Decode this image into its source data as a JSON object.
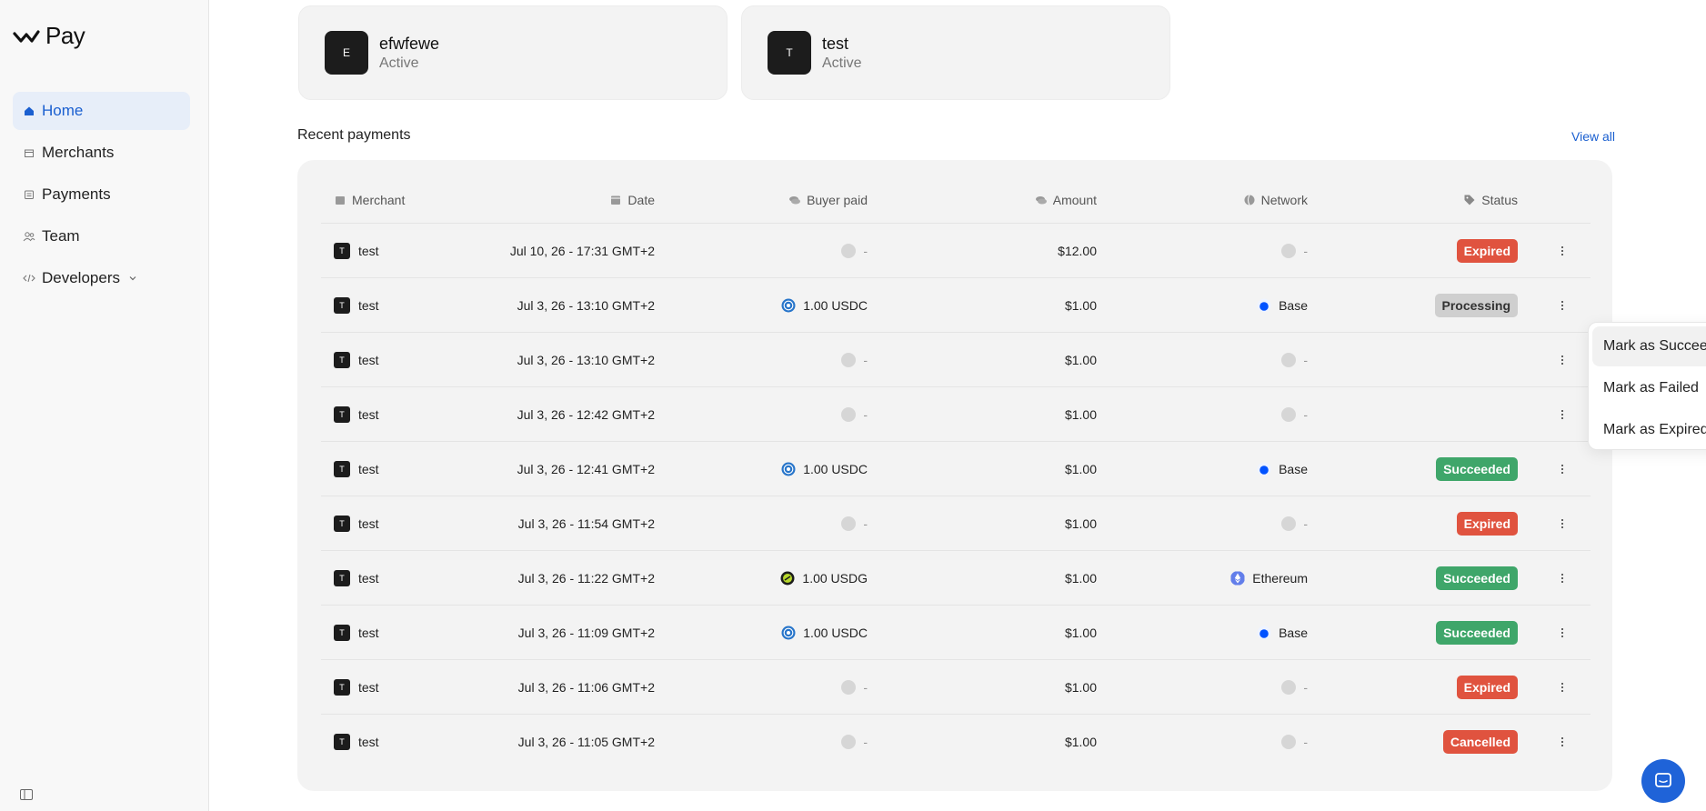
{
  "app": {
    "logo_text": "Pay"
  },
  "sidebar": {
    "items": [
      {
        "label": "Home",
        "icon": "home-icon",
        "active": true
      },
      {
        "label": "Merchants",
        "icon": "store-icon"
      },
      {
        "label": "Payments",
        "icon": "receipt-icon"
      },
      {
        "label": "Team",
        "icon": "users-icon"
      },
      {
        "label": "Developers",
        "icon": "code-icon",
        "has_dropdown": true
      }
    ]
  },
  "merchants": [
    {
      "initial": "E",
      "name": "efwfewe",
      "status": "Active"
    },
    {
      "initial": "T",
      "name": "test",
      "status": "Active"
    }
  ],
  "recent_payments": {
    "title": "Recent payments",
    "view_all": "View all",
    "columns": {
      "merchant": "Merchant",
      "date": "Date",
      "buyer_paid": "Buyer paid",
      "amount": "Amount",
      "network": "Network",
      "status": "Status"
    },
    "rows": [
      {
        "initial": "T",
        "merchant": "test",
        "date": "Jul 10, 26 - 17:31 GMT+2",
        "buyer_paid": "-",
        "amount": "$12.00",
        "network": "-",
        "status": "Expired"
      },
      {
        "initial": "T",
        "merchant": "test",
        "date": "Jul 3, 26 - 13:10 GMT+2",
        "buyer_paid": "1.00 USDC",
        "amount": "$1.00",
        "network": "Base",
        "status": "Processing"
      },
      {
        "initial": "T",
        "merchant": "test",
        "date": "Jul 3, 26 - 13:10 GMT+2",
        "buyer_paid": "-",
        "amount": "$1.00",
        "network": "-",
        "status": ""
      },
      {
        "initial": "T",
        "merchant": "test",
        "date": "Jul 3, 26 - 12:42 GMT+2",
        "buyer_paid": "-",
        "amount": "$1.00",
        "network": "-",
        "status": ""
      },
      {
        "initial": "T",
        "merchant": "test",
        "date": "Jul 3, 26 - 12:41 GMT+2",
        "buyer_paid": "1.00 USDC",
        "amount": "$1.00",
        "network": "Base",
        "status": "Succeeded"
      },
      {
        "initial": "T",
        "merchant": "test",
        "date": "Jul 3, 26 - 11:54 GMT+2",
        "buyer_paid": "-",
        "amount": "$1.00",
        "network": "-",
        "status": "Expired"
      },
      {
        "initial": "T",
        "merchant": "test",
        "date": "Jul 3, 26 - 11:22 GMT+2",
        "buyer_paid": "1.00 USDG",
        "amount": "$1.00",
        "network": "Ethereum",
        "status": "Succeeded"
      },
      {
        "initial": "T",
        "merchant": "test",
        "date": "Jul 3, 26 - 11:09 GMT+2",
        "buyer_paid": "1.00 USDC",
        "amount": "$1.00",
        "network": "Base",
        "status": "Succeeded"
      },
      {
        "initial": "T",
        "merchant": "test",
        "date": "Jul 3, 26 - 11:06 GMT+2",
        "buyer_paid": "-",
        "amount": "$1.00",
        "network": "-",
        "status": "Expired"
      },
      {
        "initial": "T",
        "merchant": "test",
        "date": "Jul 3, 26 - 11:05 GMT+2",
        "buyer_paid": "-",
        "amount": "$1.00",
        "network": "-",
        "status": "Cancelled"
      }
    ]
  },
  "status_menu": {
    "items": [
      "Mark as Succeeded",
      "Mark as Failed",
      "Mark as Expired"
    ]
  },
  "colors": {
    "accent": "#1a5fd0",
    "expired": "#e0533f",
    "succeeded": "#3fa66a",
    "processing": "#cfcfcf",
    "chat": "#1f63d8"
  }
}
